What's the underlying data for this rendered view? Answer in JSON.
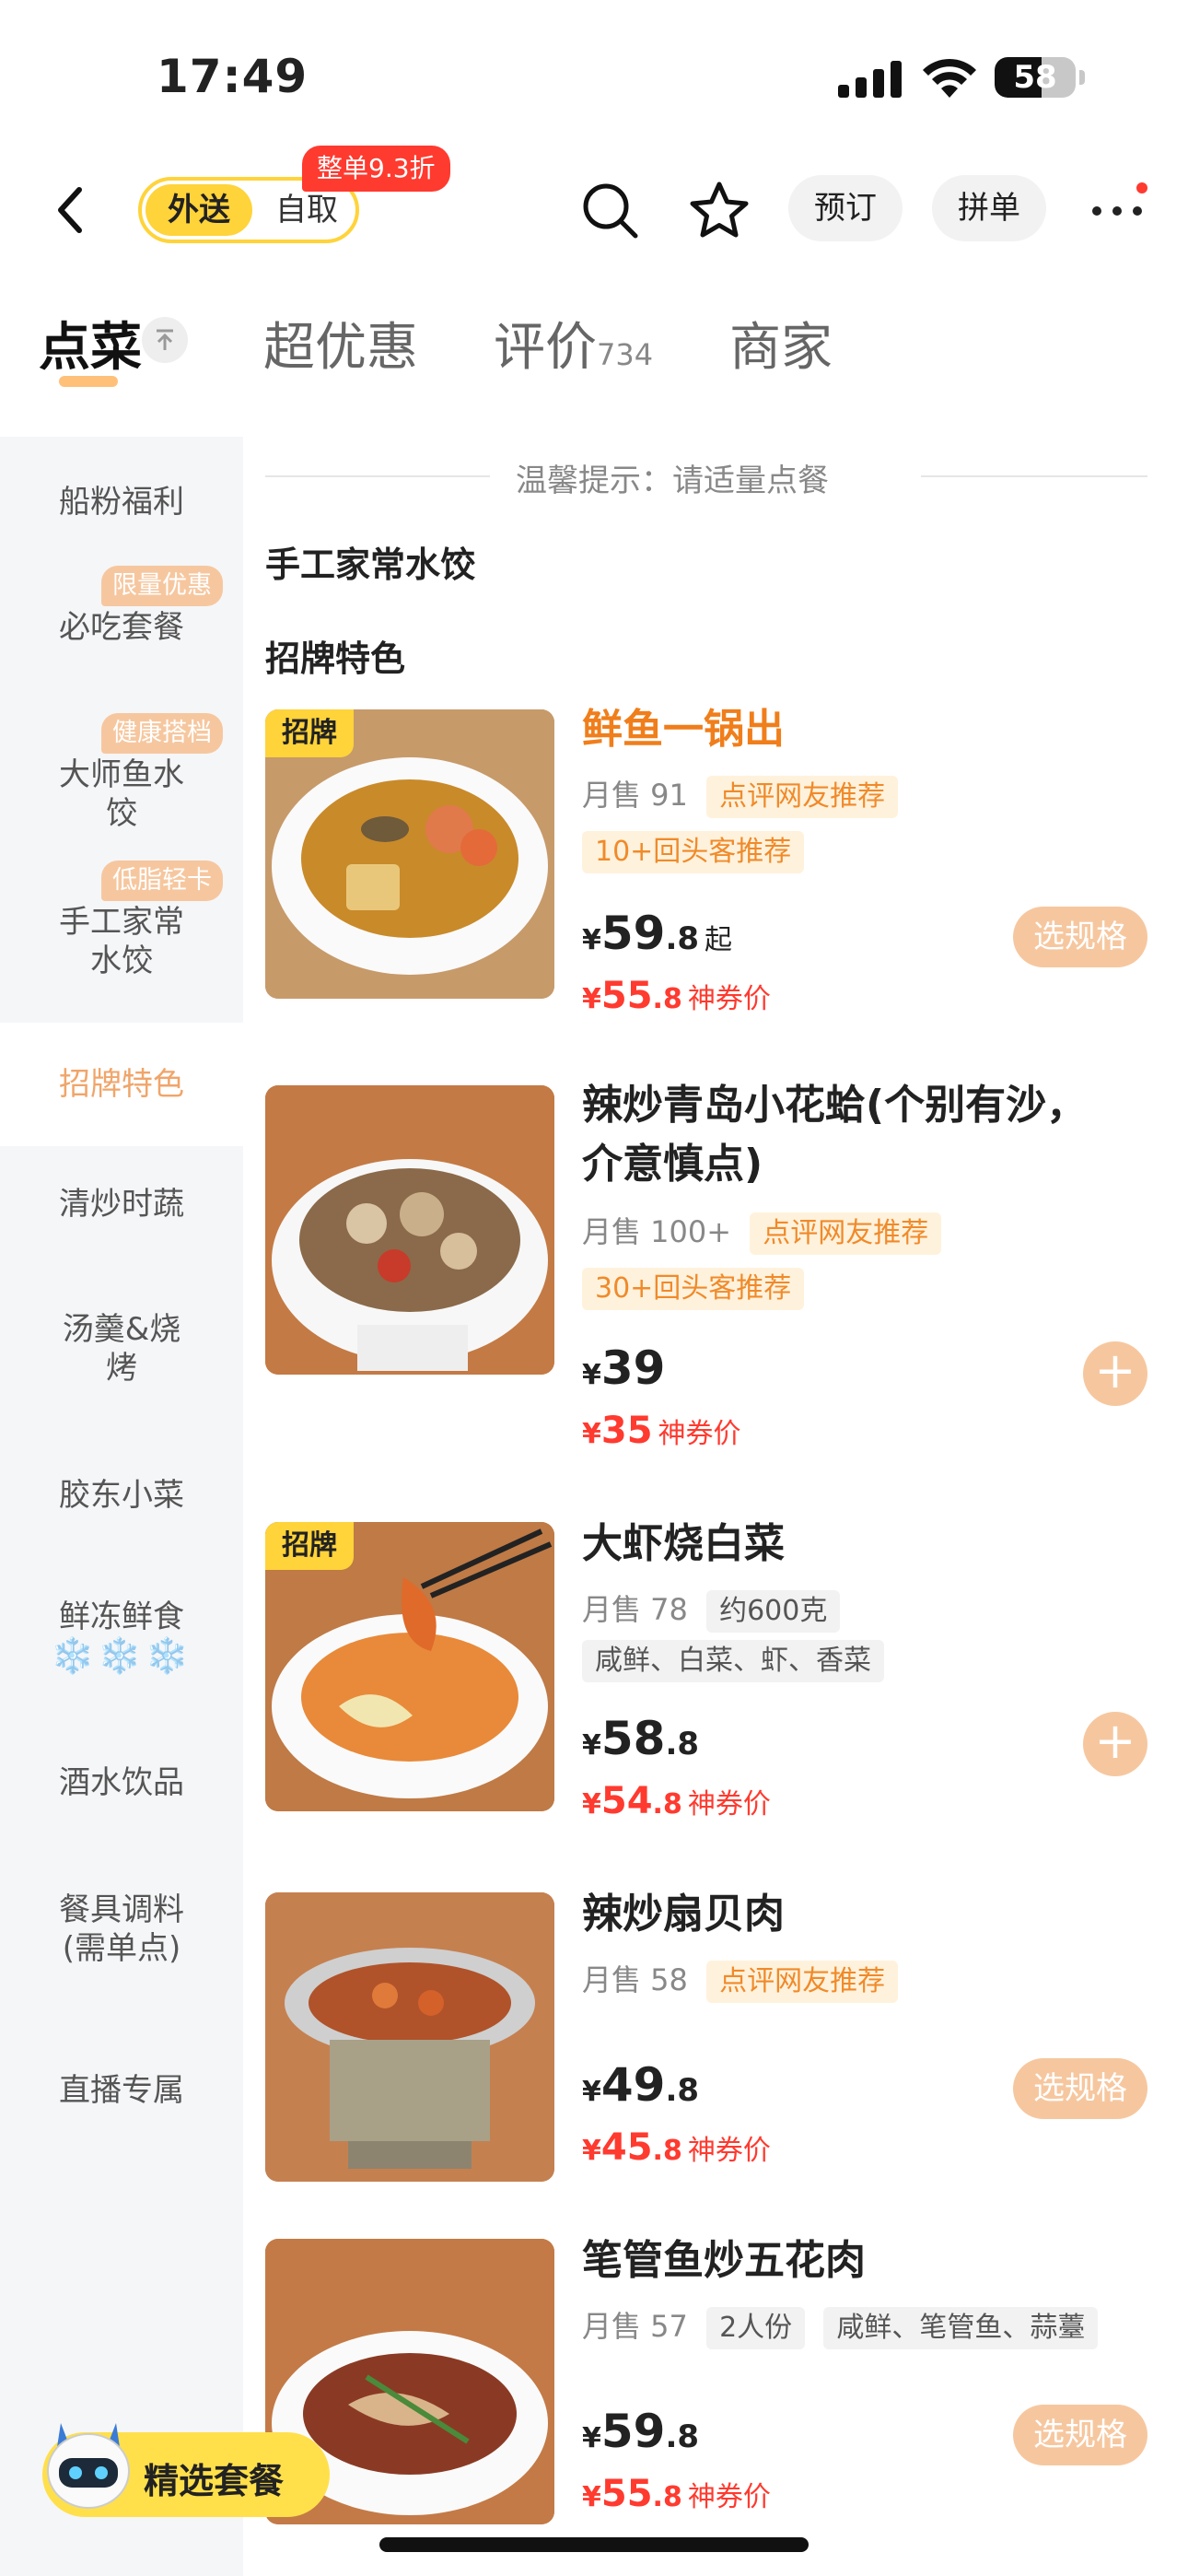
{
  "status_bar": {
    "time": "17:49",
    "battery": "58",
    "battery_level": 0.58
  },
  "nav": {
    "mode_options": [
      "外送",
      "自取"
    ],
    "promo": "整单9.3折",
    "reserve_label": "预订",
    "group_label": "拼单",
    "icons": [
      "back-icon",
      "search-icon",
      "star-icon",
      "more-icon"
    ]
  },
  "tabs": [
    {
      "label": "点菜",
      "active": true
    },
    {
      "label": "超优惠"
    },
    {
      "label": "评价",
      "count": "734"
    },
    {
      "label": "商家"
    }
  ],
  "sidebar": {
    "items": [
      {
        "label": "船粉福利"
      },
      {
        "label": "必吃套餐",
        "tag": "限量优惠"
      },
      {
        "label": "大师鱼水饺",
        "tag": "健康搭档"
      },
      {
        "label": "手工家常水饺",
        "tag": "低脂轻卡"
      },
      {
        "label": "招牌特色",
        "active": true
      },
      {
        "label": "清炒时蔬"
      },
      {
        "label": "汤羹&烧烤"
      },
      {
        "label": "胶东小菜"
      },
      {
        "label": "鲜冻鲜食",
        "extra": "❄️❄️❄️"
      },
      {
        "label": "酒水饮品"
      },
      {
        "label": "餐具调料(需单点)"
      },
      {
        "label": "直播专属"
      }
    ]
  },
  "content": {
    "notice": "温馨提示：请适量点餐",
    "section_prev": "手工家常水饺",
    "section_current": "招牌特色",
    "dishes": [
      {
        "badge": "招牌",
        "name": "鲜鱼一锅出",
        "sales": "月售 91",
        "tags_inline": [
          "点评网友推荐"
        ],
        "tags_line2": [
          "10+回头客推荐"
        ],
        "price_int": "59",
        "price_dec": ".8",
        "price_suffix": "起",
        "coupon_int": "55",
        "coupon_dec": ".8",
        "coupon_label": "神券价",
        "action": "选规格"
      },
      {
        "badge": "",
        "name": "辣炒青岛小花蛤(个别有沙，介意慎点)",
        "sales": "月售 100+",
        "tags_inline": [
          "点评网友推荐"
        ],
        "tags_line2": [
          "30+回头客推荐"
        ],
        "price_int": "39",
        "price_dec": "",
        "coupon_int": "35",
        "coupon_dec": "",
        "coupon_label": "神券价",
        "action": "+"
      },
      {
        "badge": "招牌",
        "name": "大虾烧白菜",
        "sales": "月售 78",
        "tags_grey_inline": [
          "约600克"
        ],
        "tags_grey_line2": [
          "咸鲜、白菜、虾、香菜"
        ],
        "price_int": "58",
        "price_dec": ".8",
        "coupon_int": "54",
        "coupon_dec": ".8",
        "coupon_label": "神券价",
        "action": "+"
      },
      {
        "badge": "",
        "name": "辣炒扇贝肉",
        "sales": "月售 58",
        "tags_inline": [
          "点评网友推荐"
        ],
        "price_int": "49",
        "price_dec": ".8",
        "coupon_int": "45",
        "coupon_dec": ".8",
        "coupon_label": "神券价",
        "action": "选规格"
      },
      {
        "badge": "",
        "name": "笔管鱼炒五花肉",
        "sales": "月售 57",
        "tags_grey_inline": [
          "2人份",
          "咸鲜、笔管鱼、蒜薹"
        ],
        "price_int": "59",
        "price_dec": ".8",
        "coupon_int": "55",
        "coupon_dec": ".8",
        "coupon_label": "神券价",
        "action": "选规格"
      }
    ]
  },
  "float_button": {
    "label": "精选套餐"
  },
  "currency": "¥",
  "colors": {
    "accent": "#ffd33a",
    "price_red": "#ff3a2f",
    "orange": "#f08a2a",
    "spec": "#f6c79f"
  }
}
